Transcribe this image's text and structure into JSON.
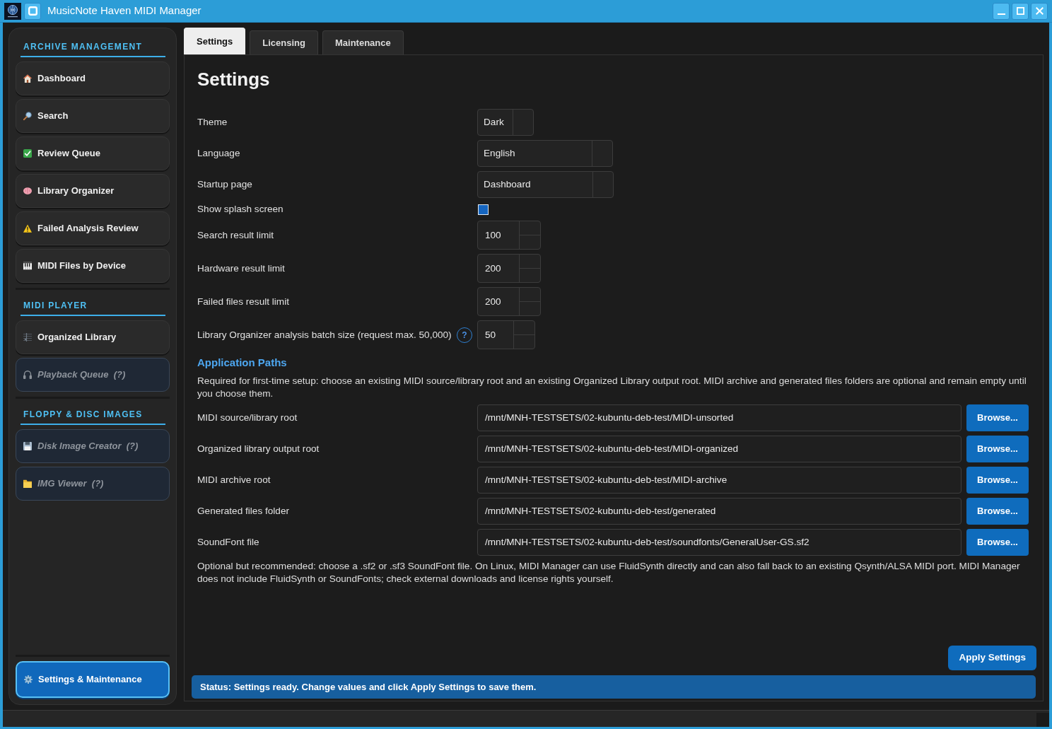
{
  "window": {
    "title": "MusicNote Haven MIDI Manager"
  },
  "sidebar": {
    "sections": [
      {
        "title": "ARCHIVE MANAGEMENT",
        "items": [
          {
            "label": "Dashboard",
            "selected": false,
            "disabled": false
          },
          {
            "label": "Search",
            "selected": false,
            "disabled": false
          },
          {
            "label": "Review Queue",
            "selected": false,
            "disabled": false
          },
          {
            "label": "Library Organizer",
            "selected": false,
            "disabled": false
          },
          {
            "label": "Failed Analysis Review",
            "selected": false,
            "disabled": false
          },
          {
            "label": "MIDI Files by Device",
            "selected": false,
            "disabled": false
          }
        ]
      },
      {
        "title": "MIDI PLAYER",
        "items": [
          {
            "label": "Organized Library",
            "selected": false,
            "disabled": false
          },
          {
            "label": "Playback Queue  (?)",
            "selected": false,
            "disabled": true
          }
        ]
      },
      {
        "title": "FLOPPY & DISC IMAGES",
        "items": [
          {
            "label": "Disk Image Creator  (?)",
            "selected": false,
            "disabled": true
          },
          {
            "label": "IMG Viewer  (?)",
            "selected": false,
            "disabled": true
          }
        ]
      }
    ],
    "footer_item": {
      "label": "Settings & Maintenance",
      "selected": true,
      "disabled": false
    }
  },
  "tabs": [
    {
      "label": "Settings",
      "selected": true
    },
    {
      "label": "Licensing",
      "selected": false
    },
    {
      "label": "Maintenance",
      "selected": false
    }
  ],
  "settings": {
    "title": "Settings",
    "fields": [
      {
        "kind": "select",
        "label": "Theme",
        "value": "Dark"
      },
      {
        "kind": "select",
        "label": "Language",
        "value": "English"
      },
      {
        "kind": "select",
        "label": "Startup page",
        "value": "Dashboard"
      },
      {
        "kind": "checkbox",
        "label": "Show splash screen",
        "checked": true
      },
      {
        "kind": "spin",
        "label": "Search result limit",
        "value": "100"
      },
      {
        "kind": "spin",
        "label": "Hardware result limit",
        "value": "200"
      },
      {
        "kind": "spin",
        "label": "Failed files result limit",
        "value": "200"
      },
      {
        "kind": "spin",
        "label": "Library Organizer analysis batch size (request max. 50,000)",
        "value": "50",
        "help": "?"
      }
    ],
    "paths_section": {
      "title": "Application Paths",
      "description": "Required for first-time setup: choose an existing MIDI source/library root and an existing Organized Library output root. MIDI archive and generated files folders are optional and remain empty until you choose them.",
      "paths": [
        {
          "label": "MIDI source/library root",
          "value": "/mnt/MNH-TESTSETS/02-kubuntu-deb-test/MIDI-unsorted",
          "button": "Browse..."
        },
        {
          "label": "Organized library output root",
          "value": "/mnt/MNH-TESTSETS/02-kubuntu-deb-test/MIDI-organized",
          "button": "Browse..."
        },
        {
          "label": "MIDI archive root",
          "value": "/mnt/MNH-TESTSETS/02-kubuntu-deb-test/MIDI-archive",
          "button": "Browse..."
        },
        {
          "label": "Generated files folder",
          "value": "/mnt/MNH-TESTSETS/02-kubuntu-deb-test/generated",
          "button": "Browse..."
        },
        {
          "label": "SoundFont file",
          "value": "/mnt/MNH-TESTSETS/02-kubuntu-deb-test/soundfonts/GeneralUser-GS.sf2",
          "button": "Browse..."
        }
      ],
      "note": "Optional but recommended: choose a .sf2 or .sf3 SoundFont file. On Linux, MIDI Manager can use FluidSynth directly and can also fall back to an existing Qsynth/ALSA MIDI port. MIDI Manager does not include FluidSynth or SoundFonts; check external downloads and license rights yourself."
    },
    "apply_button": "Apply Settings",
    "status": "Status: Settings ready. Change values and click Apply Settings to save them."
  }
}
